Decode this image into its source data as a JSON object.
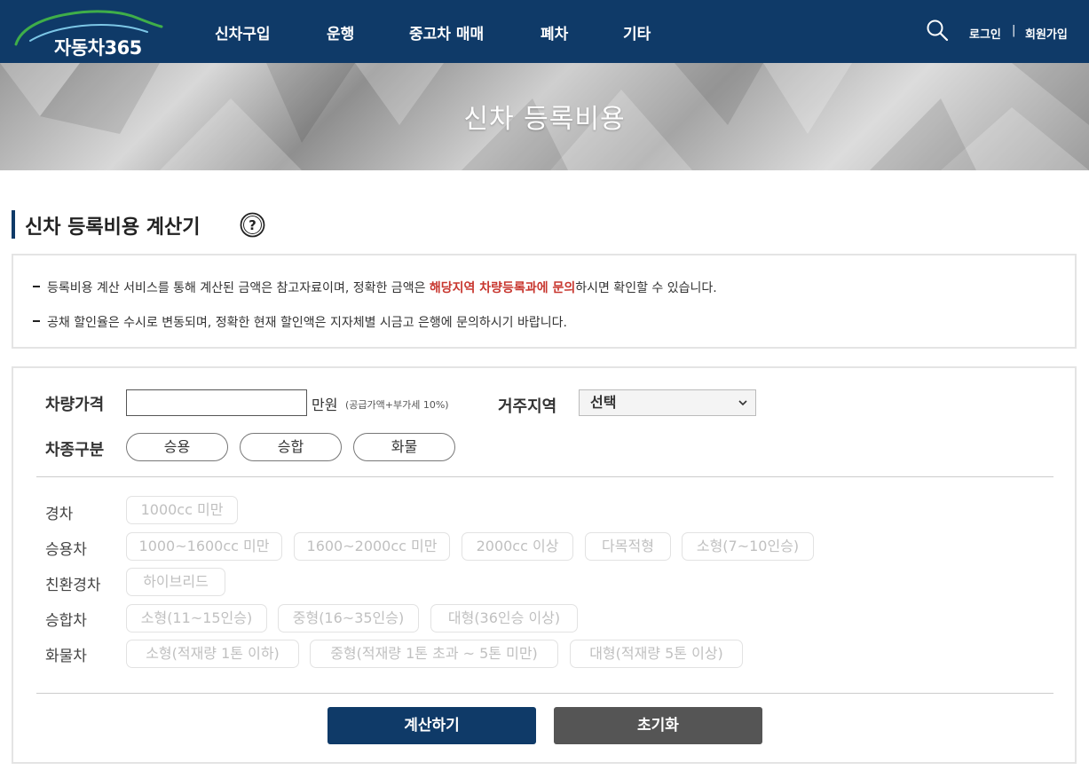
{
  "header": {
    "logo_text": "자동차365",
    "nav": [
      "신차구입",
      "운행",
      "중고차 매매",
      "폐차",
      "기타"
    ],
    "login_label": "로그인",
    "separator": "|",
    "signup_label": "회원가입"
  },
  "banner": {
    "title": "신차 등록비용"
  },
  "section": {
    "title": "신차 등록비용 계산기"
  },
  "notice": {
    "line1_pre": "등록비용 계산 서비스를 통해 계산된 금액은 참고자료이며, 정확한 금액은 ",
    "line1_em": "해당지역 차량등록과에 문의",
    "line1_post": "하시면 확인할 수 있습니다.",
    "line2": "공채 할인율은 수시로 변동되며, 정확한 현재 할인액은 지자체별 시금고 은행에 문의하시기 바랍니다."
  },
  "form": {
    "price_label": "차량가격",
    "price_value": "",
    "price_unit": "만원",
    "price_note": "(공급가액+부가세 10%)",
    "region_label": "거주지역",
    "region_selected": "선택",
    "type_label": "차종구분",
    "types": [
      "승용",
      "승합",
      "화물"
    ],
    "categories": [
      {
        "label": "경차",
        "options": [
          "1000cc 미만"
        ]
      },
      {
        "label": "승용차",
        "options": [
          "1000~1600cc 미만",
          "1600~2000cc 미만",
          "2000cc 이상",
          "다목적형",
          "소형(7~10인승)"
        ]
      },
      {
        "label": "친환경차",
        "options": [
          "하이브리드"
        ]
      },
      {
        "label": "승합차",
        "options": [
          "소형(11~15인승)",
          "중형(16~35인승)",
          "대형(36인승 이상)"
        ]
      },
      {
        "label": "화물차",
        "options": [
          "소형(적재량 1톤 이하)",
          "중형(적재량 1톤 초과 ~ 5톤 미만)",
          "대형(적재량 5톤 이상)"
        ]
      }
    ],
    "calc_button": "계산하기",
    "reset_button": "초기화"
  },
  "colors": {
    "header_bg": "#0f3a68",
    "accent_text": "#c8372f",
    "calc_button_bg": "#0f3a68",
    "reset_button_bg": "#555555"
  }
}
